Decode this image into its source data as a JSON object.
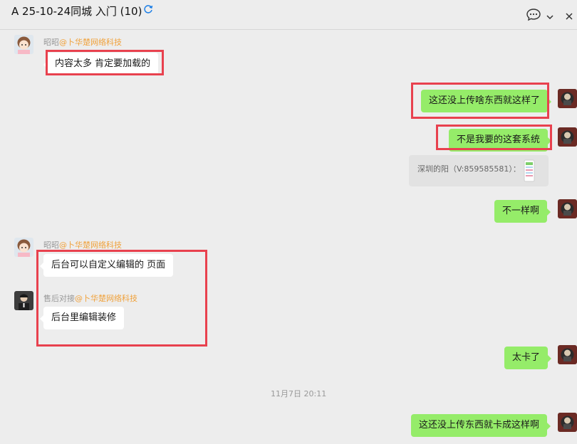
{
  "header": {
    "title": "A 25-10-24同城  入门 (10)",
    "icons": [
      "refresh-icon",
      "chat-bubble-icon",
      "chevron-down-icon",
      "close-icon"
    ]
  },
  "messages": [
    {
      "id": "m1",
      "direction": "incoming",
      "sender_name": "昭昭",
      "sender_org": "@卜华楚网络科技",
      "text": "内容太多 肯定要加载的"
    },
    {
      "id": "m2",
      "direction": "outgoing",
      "text": "这还没上传啥东西就这样了"
    },
    {
      "id": "m3",
      "direction": "outgoing",
      "text": "不是我要的这套系统"
    },
    {
      "id": "m4",
      "direction": "outgoing",
      "type": "contact_card",
      "text": "深圳的阳（V:859585581）："
    },
    {
      "id": "m5",
      "direction": "outgoing",
      "text": "不一样啊"
    },
    {
      "id": "m6",
      "direction": "incoming",
      "sender_name": "昭昭",
      "sender_org": "@卜华楚网络科技",
      "text": "后台可以自定义编辑的  页面"
    },
    {
      "id": "m7",
      "direction": "incoming",
      "sender_name": "售后对接",
      "sender_org": "@卜华楚网络科技",
      "text": "后台里编辑装修"
    },
    {
      "id": "m8",
      "direction": "outgoing",
      "text": "太卡了"
    },
    {
      "id": "m9",
      "direction": "outgoing",
      "text": "这还没上传东西就卡成这样啊"
    }
  ],
  "timestamp": "11月7日 20:11",
  "colors": {
    "background": "#ededed",
    "outgoing_bubble": "#95ec69",
    "incoming_bubble": "#ffffff",
    "org_label": "#f0a13a",
    "highlight_box": "#e8414e"
  }
}
